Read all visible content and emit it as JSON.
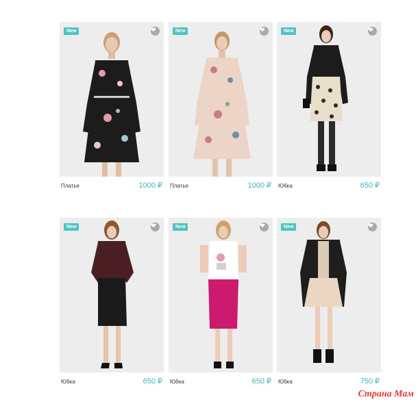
{
  "products": [
    {
      "badge": "New",
      "category": "Платье",
      "price": "1000 ₽",
      "icon": "heart-icon"
    },
    {
      "badge": "New",
      "category": "Платье",
      "price": "1000 ₽",
      "icon": "heart-icon"
    },
    {
      "badge": "New",
      "category": "Юбка",
      "price": "650 ₽",
      "icon": "heart-icon"
    },
    {
      "badge": "New",
      "category": "Юбка",
      "price": "650 ₽",
      "icon": "heart-icon"
    },
    {
      "badge": "New",
      "category": "Юбка",
      "price": "650 ₽",
      "icon": "heart-icon"
    },
    {
      "badge": "New",
      "category": "Юбка",
      "price": "750 ₽",
      "icon": "heart-icon"
    }
  ],
  "watermark": "Страна Мам",
  "colors": {
    "accent": "#3bb6bd",
    "badge": "#4fc3c1",
    "watermark": "#e53935"
  }
}
